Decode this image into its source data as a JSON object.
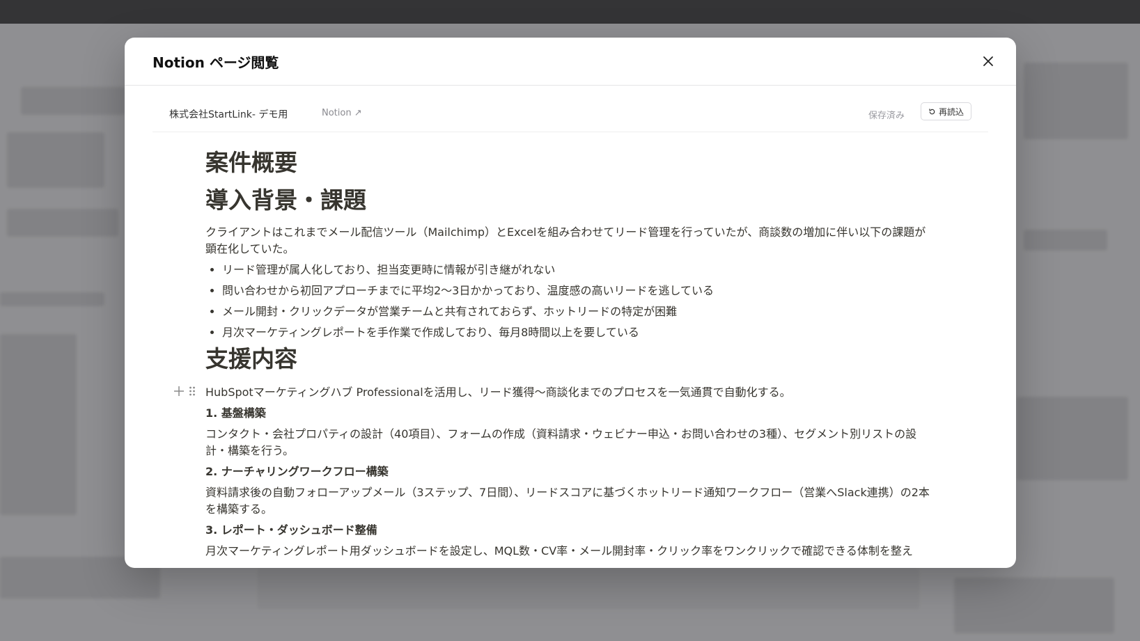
{
  "modal": {
    "title": "Notion ページ閲覧"
  },
  "doc_bar": {
    "page_name": "株式会社StartLink- デモ用",
    "notion_link": "Notion ↗",
    "saved_status": "保存済み",
    "reload_label": "再読込"
  },
  "content": {
    "heading_overview": "案件概要",
    "heading_background": "導入背景・課題",
    "background_para": "クライアントはこれまでメール配信ツール（Mailchimp）とExcelを組み合わせてリード管理を行っていたが、商談数の増加に伴い以下の課題が顕在化していた。",
    "issues": [
      "リード管理が属人化しており、担当変更時に情報が引き継がれない",
      "問い合わせから初回アプローチまでに平均2〜3日かかっており、温度感の高いリードを逃している",
      "メール開封・クリックデータが営業チームと共有されておらず、ホットリードの特定が困難",
      "月次マーケティングレポートを手作業で作成しており、毎月8時間以上を要している"
    ],
    "heading_support": "支援内容",
    "support_para": "HubSpotマーケティングハブ Professionalを活用し、リード獲得〜商談化までのプロセスを一気通貫で自動化する。",
    "sections": [
      {
        "title": "1. 基盤構築",
        "body": "コンタクト・会社プロパティの設計（40項目）、フォームの作成（資料請求・ウェビナー申込・お問い合わせの3種）、セグメント別リストの設計・構築を行う。"
      },
      {
        "title": "2. ナーチャリングワークフロー構築",
        "body": "資料請求後の自動フォローアップメール（3ステップ、7日間）、リードスコアに基づくホットリード通知ワークフロー（営業へSlack連携）の2本を構築する。"
      },
      {
        "title": "3. レポート・ダッシュボード整備",
        "body": "月次マーケティングレポート用ダッシュボードを設定し、MQL数・CV率・メール開封率・クリック率をワンクリックで確認できる体制を整え"
      }
    ]
  }
}
